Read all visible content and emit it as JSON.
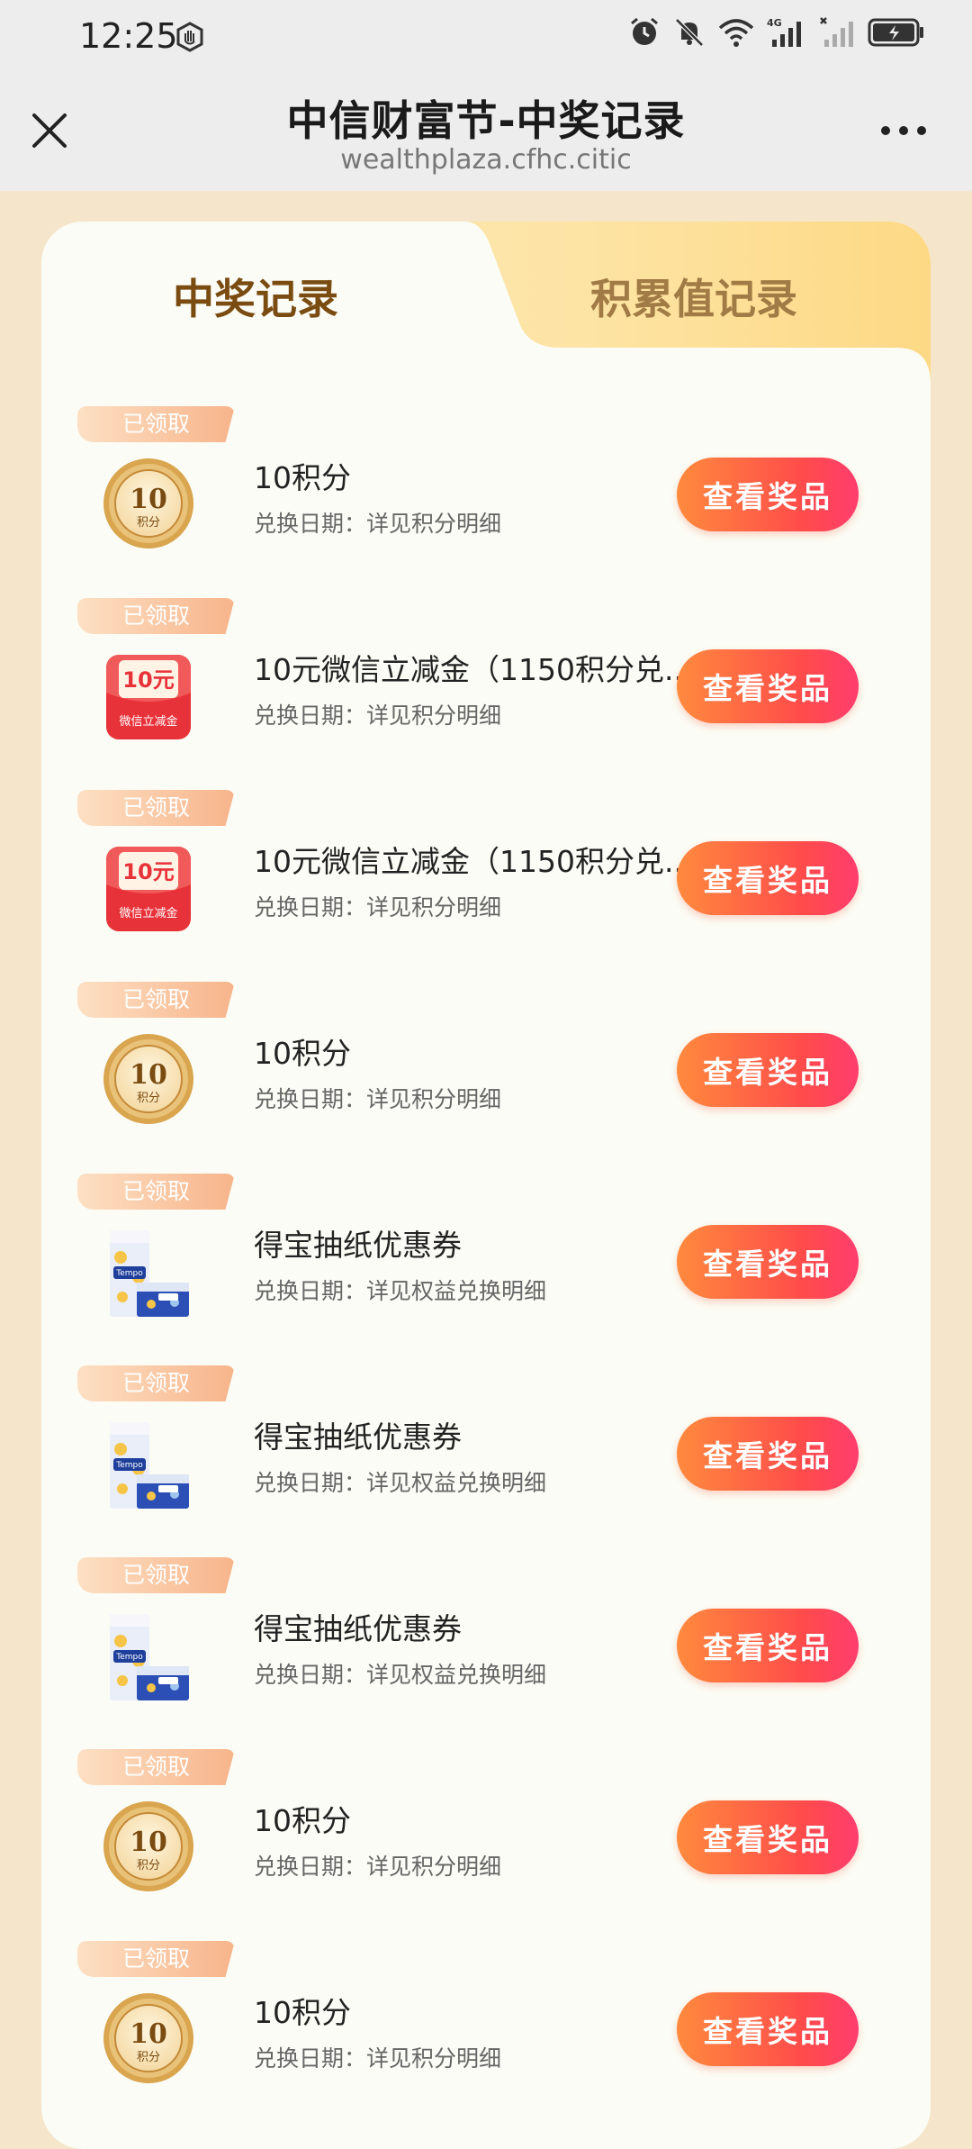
{
  "status_bar": {
    "time": "12:25",
    "icons": [
      "privacy-hand-icon",
      "alarm-icon",
      "mute-icon",
      "wifi-icon",
      "4g-signal-icon",
      "no-signal-icon",
      "battery-charging-icon"
    ],
    "network_label": "4G"
  },
  "header": {
    "title": "中信财富节-中奖记录",
    "url": "wealthplaza.cfhc.citic"
  },
  "tabs": [
    {
      "label": "中奖记录",
      "active": true
    },
    {
      "label": "积累值记录",
      "active": false
    }
  ],
  "records": [
    {
      "status": "已领取",
      "title": "10积分",
      "subtitle": "兑换日期：详见积分明细",
      "button": "查看奖品",
      "icon": "points-coin-icon"
    },
    {
      "status": "已领取",
      "title": "10元微信立减金（1150积分兑...",
      "subtitle": "兑换日期：详见积分明细",
      "button": "查看奖品",
      "icon": "red-envelope-icon"
    },
    {
      "status": "已领取",
      "title": "10元微信立减金（1150积分兑...",
      "subtitle": "兑换日期：详见积分明细",
      "button": "查看奖品",
      "icon": "red-envelope-icon"
    },
    {
      "status": "已领取",
      "title": "10积分",
      "subtitle": "兑换日期：详见积分明细",
      "button": "查看奖品",
      "icon": "points-coin-icon"
    },
    {
      "status": "已领取",
      "title": "得宝抽纸优惠券",
      "subtitle": "兑换日期：详见权益兑换明细",
      "button": "查看奖品",
      "icon": "tissue-box-icon"
    },
    {
      "status": "已领取",
      "title": "得宝抽纸优惠券",
      "subtitle": "兑换日期：详见权益兑换明细",
      "button": "查看奖品",
      "icon": "tissue-box-icon"
    },
    {
      "status": "已领取",
      "title": "得宝抽纸优惠券",
      "subtitle": "兑换日期：详见权益兑换明细",
      "button": "查看奖品",
      "icon": "tissue-box-icon"
    },
    {
      "status": "已领取",
      "title": "10积分",
      "subtitle": "兑换日期：详见积分明细",
      "button": "查看奖品",
      "icon": "points-coin-icon"
    },
    {
      "status": "已领取",
      "title": "10积分",
      "subtitle": "兑换日期：详见积分明细",
      "button": "查看奖品",
      "icon": "points-coin-icon"
    }
  ],
  "coin_text": {
    "value": "10",
    "unit": "积分"
  },
  "envelope_text": {
    "value": "10元",
    "caption": "微信立减金"
  },
  "colors": {
    "page_bg": "#f5e6cb",
    "card_bg": "#fbfcf5",
    "active_tab_text": "#7a4c12",
    "inactive_tab_text": "#a17b45",
    "button_gradient_start": "#ff8a3d",
    "button_gradient_end": "#ff3d6e"
  }
}
